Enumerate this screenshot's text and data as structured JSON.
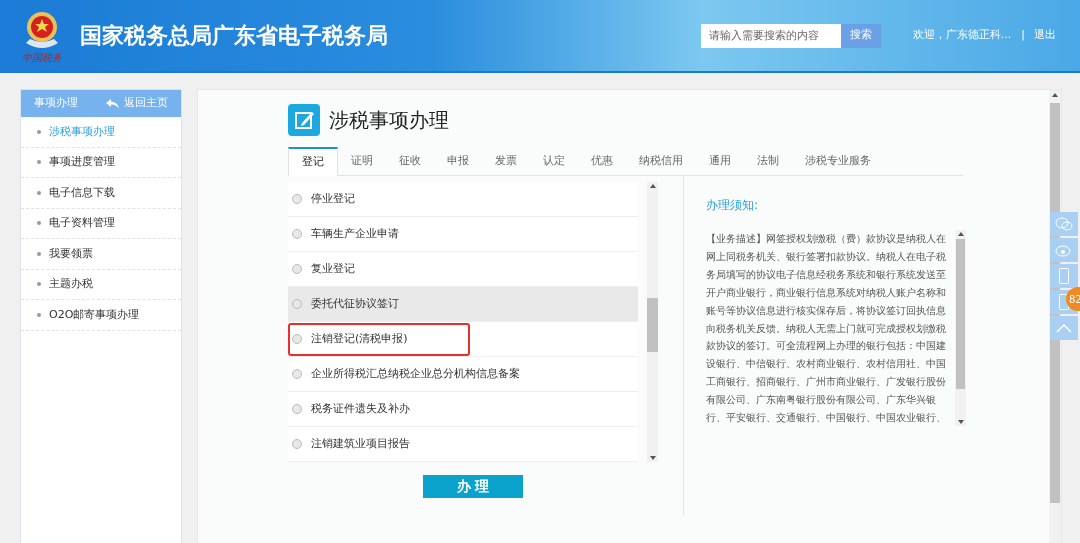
{
  "header": {
    "title": "国家税务总局广东省电子税务局",
    "logo_caption": "中国税务",
    "search": {
      "placeholder": "请输入需要搜索的内容",
      "button": "搜索"
    },
    "welcome": "欢迎，广东德正科...",
    "separator": "|",
    "logout": "退出"
  },
  "sidebar": {
    "title": "事项办理",
    "back": "返回主页",
    "items": [
      {
        "label": "涉税事项办理",
        "selected": true
      },
      {
        "label": "事项进度管理",
        "selected": false
      },
      {
        "label": "电子信息下载",
        "selected": false
      },
      {
        "label": "电子资料管理",
        "selected": false
      },
      {
        "label": "我要领票",
        "selected": false
      },
      {
        "label": "主题办税",
        "selected": false
      },
      {
        "label": "O2O邮寄事项办理",
        "selected": false
      }
    ]
  },
  "page_title": "涉税事项办理",
  "tabs": [
    {
      "label": "登记",
      "selected": true
    },
    {
      "label": "证明",
      "selected": false
    },
    {
      "label": "征收",
      "selected": false
    },
    {
      "label": "申报",
      "selected": false
    },
    {
      "label": "发票",
      "selected": false
    },
    {
      "label": "认定",
      "selected": false
    },
    {
      "label": "优惠",
      "selected": false
    },
    {
      "label": "纳税信用",
      "selected": false
    },
    {
      "label": "通用",
      "selected": false
    },
    {
      "label": "法制",
      "selected": false
    },
    {
      "label": "涉税专业服务",
      "selected": false
    }
  ],
  "items": [
    {
      "label": "停业登记",
      "checked": false,
      "hovered": false,
      "highlighted": false
    },
    {
      "label": "车辆生产企业申请",
      "checked": false,
      "hovered": false,
      "highlighted": false
    },
    {
      "label": "复业登记",
      "checked": false,
      "hovered": false,
      "highlighted": false
    },
    {
      "label": "委托代征协议签订",
      "checked": false,
      "hovered": true,
      "highlighted": false
    },
    {
      "label": "注销登记(清税申报)",
      "checked": false,
      "hovered": false,
      "highlighted": true
    },
    {
      "label": "企业所得税汇总纳税企业总分机构信息备案",
      "checked": false,
      "hovered": false,
      "highlighted": false
    },
    {
      "label": "税务证件遗失及补办",
      "checked": false,
      "hovered": false,
      "highlighted": false
    },
    {
      "label": "注销建筑业项目报告",
      "checked": false,
      "hovered": false,
      "highlighted": false
    }
  ],
  "action_button": "办 理",
  "notice": {
    "title": "办理须知:",
    "text": "【业务描述】网签授权划缴税（费）款协议是纳税人在网上同税务机关、银行签署扣款协议。纳税人在电子税务局填写的协议电子信息经税务系统和银行系统发送至开户商业银行，商业银行信息系统对纳税人账户名称和账号等协议信息进行核实保存后，将协议签订回执信息向税务机关反馈。纳税人无需上门就可完成授权划缴税款协议的签订。可全流程网上办理的银行包括：中国建设银行、中信银行、农村商业银行、农村信用社、中国工商银行、招商银行、广州市商业银行、广发银行股份有限公司、广东南粤银行股份有限公司、广东华兴银行、平安银行、交通银行、中国银行、中国农业银行、"
  },
  "badge": "82"
}
